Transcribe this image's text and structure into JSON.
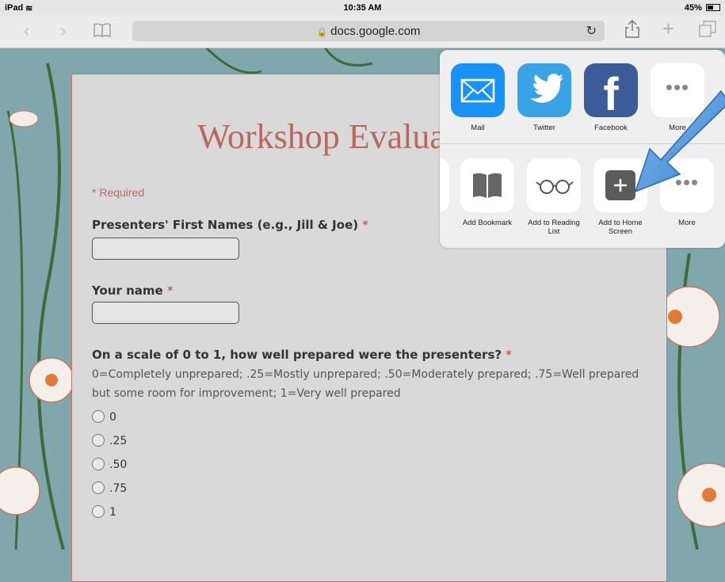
{
  "status_bar": {
    "device": "iPad",
    "time": "10:35 AM",
    "battery": "45%"
  },
  "toolbar": {
    "url": "docs.google.com",
    "back_icon": "chevron-left-icon",
    "forward_icon": "chevron-right-icon",
    "bookmarks_icon": "book-icon",
    "share_icon": "share-icon",
    "new_tab_icon": "plus-icon",
    "tabs_icon": "tabs-icon"
  },
  "form": {
    "title": "Workshop Evaluation",
    "required_note": "* Required",
    "questions": [
      {
        "label": "Presenters' First Names (e.g., Jill & Joe)",
        "required_mark": "*"
      },
      {
        "label": "Your name",
        "required_mark": "*"
      },
      {
        "label": "On a scale of 0 to 1, how well prepared were the presenters?",
        "required_mark": "*",
        "description_line1": "0=Completely unprepared; .25=Mostly unprepared; .50=Moderately prepared; .75=Well prepared",
        "description_line2": "but some room for improvement; 1=Very well prepared",
        "options": [
          "0",
          ".25",
          ".50",
          ".75",
          "1"
        ]
      }
    ]
  },
  "share_sheet": {
    "apps": [
      {
        "label": "Mail",
        "icon": "mail-icon"
      },
      {
        "label": "Twitter",
        "icon": "twitter-icon"
      },
      {
        "label": "Facebook",
        "icon": "facebook-icon"
      },
      {
        "label": "More",
        "icon": "more-icon"
      }
    ],
    "actions": [
      {
        "label": "Add Bookmark",
        "icon": "book-icon"
      },
      {
        "label": "Add to Reading List",
        "icon": "glasses-icon"
      },
      {
        "label": "Add to Home Screen",
        "icon": "add-home-icon"
      },
      {
        "label": "More",
        "icon": "more-icon"
      }
    ]
  },
  "colors": {
    "accent": "#b9685d",
    "wallpaper": "#7fa7ac",
    "arrow": "#5a9fe0"
  }
}
